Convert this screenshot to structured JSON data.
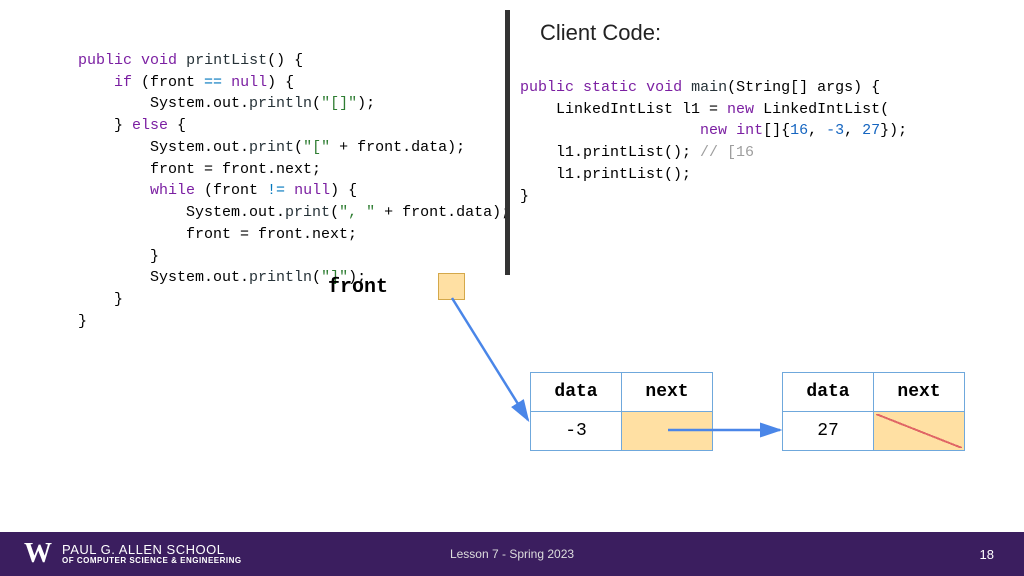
{
  "client_heading": "Client Code:",
  "code_left": {
    "l1a": "public",
    "l1b": "void",
    "l1c": "printList",
    "l1d": "() {",
    "l2a": "if",
    "l2b": " (front ",
    "l2c": "==",
    "l2d": "null",
    "l2e": ") {",
    "l3a": "        System.out.",
    "l3b": "println",
    "l3c": "(",
    "l3d": "\"[]\"",
    "l3e": ");",
    "l4a": "    } ",
    "l4b": "else",
    "l4c": " {",
    "l5a": "        System.out.",
    "l5b": "print",
    "l5c": "(",
    "l5d": "\"[\"",
    "l5e": " + front.data);",
    "l6": "        front = front.next;",
    "l7a": "while",
    "l7b": " (front ",
    "l7c": "!=",
    "l7d": "null",
    "l7e": ") {",
    "l8a": "            System.out.",
    "l8b": "print",
    "l8c": "(",
    "l8d": "\", \"",
    "l8e": " + front.data);",
    "l9": "            front = front.next;",
    "l10": "        }",
    "l11a": "        System.out.",
    "l11b": "println",
    "l11c": "(",
    "l11d": "\"]\"",
    "l11e": ");",
    "l12": "    }",
    "l13": "}"
  },
  "code_right": {
    "r1a": "public",
    "r1b": "static",
    "r1c": "void",
    "r1d": "main",
    "r1e": "(String[] args) {",
    "r2a": "    LinkedIntList l1 = ",
    "r2b": "new",
    "r2c": " LinkedIntList(",
    "r3a": "new",
    "r3b": "int",
    "r3c": "[]{",
    "r3d": "16",
    "r3e": ", ",
    "r3f": "-3",
    "r3g": ", ",
    "r3h": "27",
    "r3i": "});",
    "r4a": "    l1.printList(); ",
    "r4b": "// [16",
    "r5": "    l1.printList();",
    "r6": "}"
  },
  "front_label": "front",
  "node_headers": {
    "data": "data",
    "next": "next"
  },
  "node1_value": "-3",
  "node2_value": "27",
  "footer": {
    "w": "W",
    "school_top": "PAUL G. ALLEN SCHOOL",
    "school_bot": "OF COMPUTER SCIENCE & ENGINEERING",
    "center": "Lesson 7 - Spring 2023",
    "page": "18"
  }
}
